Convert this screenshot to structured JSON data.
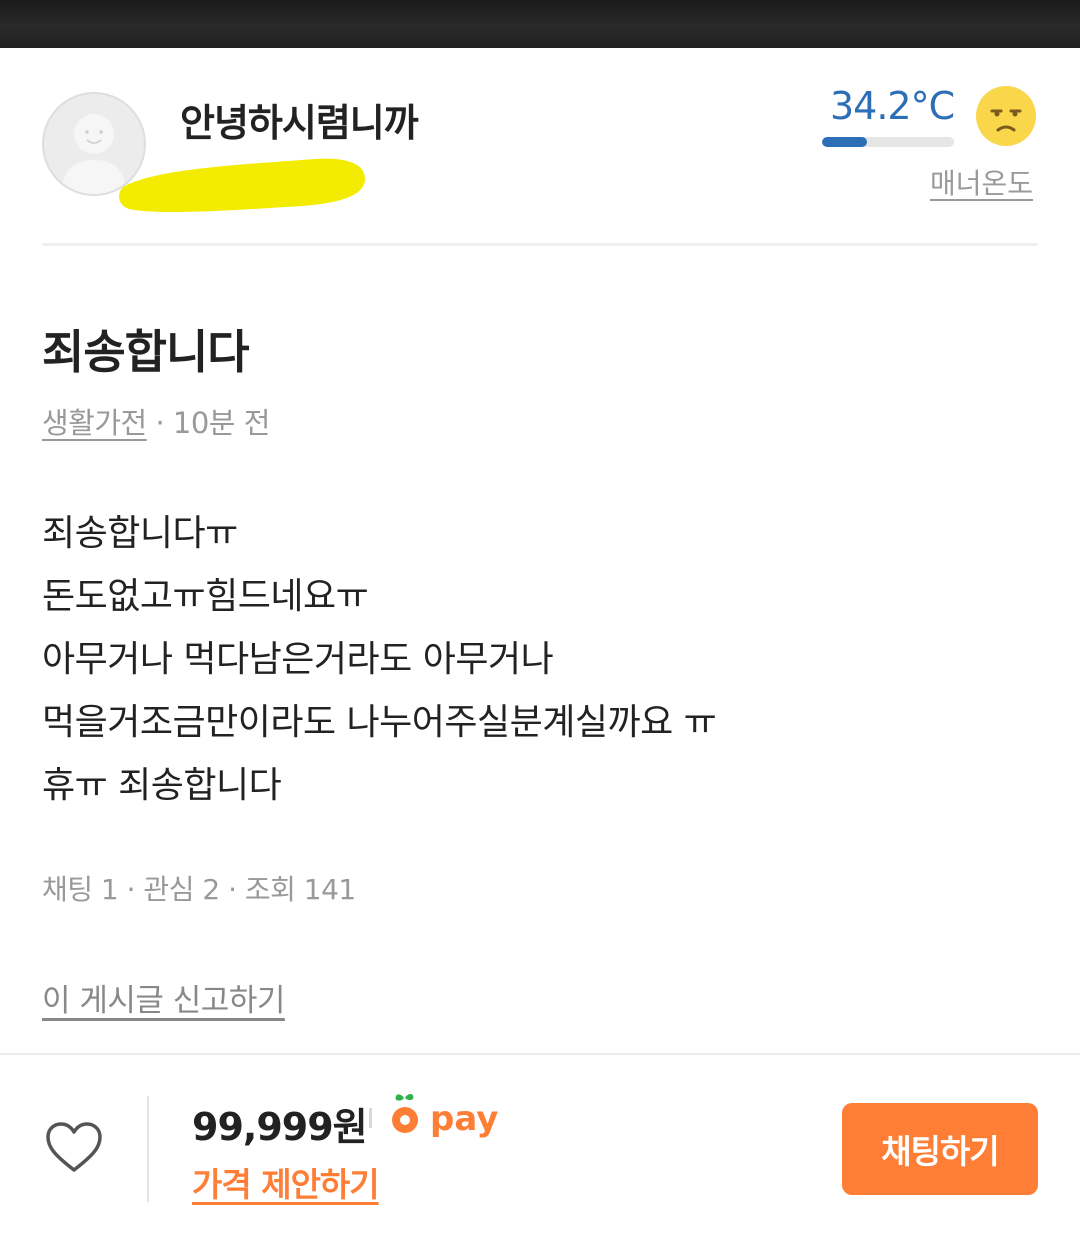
{
  "profile": {
    "nickname": "안녕하시렴니까",
    "manner_temp": "34.2°C",
    "manner_temp_value": 34.2,
    "manner_bar_fill_fraction": 0.34,
    "manner_label": "매너온도",
    "temp_icon": "sad-face-icon",
    "temp_color": "#2c6fb7"
  },
  "post": {
    "title": "죄송합니다",
    "category": "생활가전",
    "time": " · 10분 전",
    "body_lines": [
      "죄송합니다ㅠ",
      "돈도없고ㅠ힘드네요ㅠ",
      "아무거나 먹다남은거라도 아무거나",
      "먹을거조금만이라도 나누어주실분계실까요 ㅠ",
      "휴ㅠ 죄송합니다"
    ],
    "stats": "채팅 1 · 관심 2 · 조회 141",
    "report_label": "이 게시글 신고하기"
  },
  "bottom_bar": {
    "like_icon": "heart-outline-icon",
    "price": "99,999원",
    "pay_label": "pay",
    "price_offer_label": "가격 제안하기",
    "chat_button_label": "채팅하기",
    "accent_color": "#ff7e36"
  }
}
